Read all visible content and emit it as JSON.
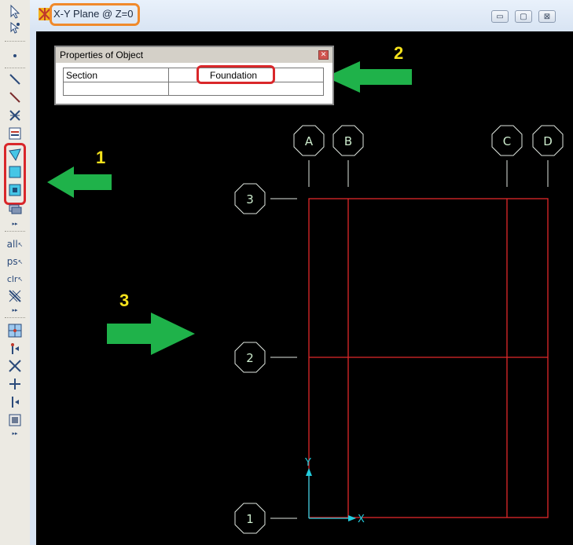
{
  "window": {
    "title": "X-Y Plane @ Z=0",
    "buttons": {
      "minimize": "▭",
      "maximize": "▢",
      "close": "⊠"
    }
  },
  "properties_panel": {
    "title": "Properties of Object",
    "rows": [
      {
        "label": "Section",
        "value": "Foundation"
      }
    ]
  },
  "grid": {
    "column_labels": [
      "A",
      "B",
      "C",
      "D"
    ],
    "row_labels": [
      "3",
      "2",
      "1"
    ]
  },
  "axes": {
    "x_label": "X",
    "y_label": "Y"
  },
  "annotations": {
    "marker_1": "1",
    "marker_2": "2",
    "marker_3": "3"
  },
  "toolbar": {
    "tool_all": "all",
    "tool_ps": "ps",
    "tool_clr": "clr",
    "icons": [
      "pointer-icon",
      "reshape-icon",
      "point-icon",
      "line-icon",
      "line-icon",
      "cross-brace-icon",
      "table-icon",
      "draw-area-icon",
      "rectangle-area-icon",
      "quick-area-icon",
      "extrude-icon",
      "select-all-icon",
      "previous-select-icon",
      "clear-select-icon",
      "intersect-icon",
      "snap-joint-icon",
      "snap-line-end-icon",
      "snap-intersection-icon",
      "snap-perpendicular-icon",
      "snap-line-icon",
      "snap-grid-icon"
    ]
  },
  "colors": {
    "canvas": "#000000",
    "grid_lines": "#e0282a",
    "bubble_outline": "#dfe6df",
    "axis": "#22ccdd",
    "arrow": "#1fb24a",
    "title_highlight": "#f08a2c",
    "callout_highlight": "#d9272a",
    "marker_number": "#f5e21c"
  }
}
